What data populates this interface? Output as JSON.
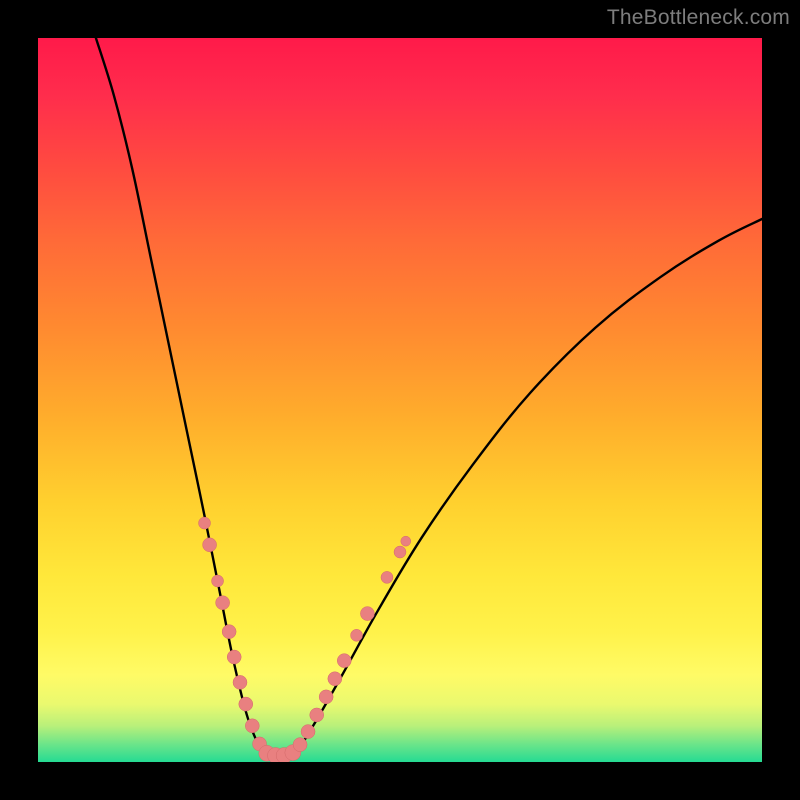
{
  "watermark": "TheBottleneck.com",
  "colors": {
    "curve_stroke": "#000000",
    "dot_fill": "#e98080",
    "dot_stroke": "#d46a6a",
    "tooltip_bg": "rgba(0,0,0,0.72)"
  },
  "chart_data": {
    "type": "line",
    "title": "",
    "xlabel": "",
    "ylabel": "",
    "xlim": [
      0,
      100
    ],
    "ylim": [
      0,
      100
    ],
    "grid": false,
    "legend": false,
    "note": "Valley curve. y encodes bottleneck percentage (0 at the valley floor, ~100 at top). x is an abstract hardware-balance axis. Lower is better (green).",
    "curve": {
      "description": "Asymmetric V: steep left branch from top-left to valley near x≈29–36, shallower right branch rising toward upper right.",
      "left_branch": [
        {
          "x": 8.0,
          "y": 100.0
        },
        {
          "x": 10.5,
          "y": 92.0
        },
        {
          "x": 13.0,
          "y": 82.0
        },
        {
          "x": 15.5,
          "y": 70.0
        },
        {
          "x": 18.0,
          "y": 58.0
        },
        {
          "x": 20.5,
          "y": 46.0
        },
        {
          "x": 23.0,
          "y": 34.0
        },
        {
          "x": 25.0,
          "y": 24.0
        },
        {
          "x": 27.0,
          "y": 14.0
        },
        {
          "x": 29.0,
          "y": 6.0
        },
        {
          "x": 31.0,
          "y": 1.5
        }
      ],
      "valley": [
        {
          "x": 31.0,
          "y": 1.5
        },
        {
          "x": 32.5,
          "y": 0.6
        },
        {
          "x": 34.0,
          "y": 0.6
        },
        {
          "x": 35.5,
          "y": 1.2
        }
      ],
      "right_branch": [
        {
          "x": 35.5,
          "y": 1.2
        },
        {
          "x": 38.0,
          "y": 5.0
        },
        {
          "x": 42.0,
          "y": 12.0
        },
        {
          "x": 47.0,
          "y": 21.0
        },
        {
          "x": 53.0,
          "y": 31.0
        },
        {
          "x": 60.0,
          "y": 41.0
        },
        {
          "x": 68.0,
          "y": 51.0
        },
        {
          "x": 77.0,
          "y": 60.0
        },
        {
          "x": 86.0,
          "y": 67.0
        },
        {
          "x": 94.0,
          "y": 72.0
        },
        {
          "x": 100.0,
          "y": 75.0
        }
      ]
    },
    "scatter": {
      "description": "Pink dots clustered along both branches of the V near the bottom.",
      "points": [
        {
          "x": 23.0,
          "y": 33.0,
          "r": 6
        },
        {
          "x": 23.7,
          "y": 30.0,
          "r": 7
        },
        {
          "x": 24.8,
          "y": 25.0,
          "r": 6
        },
        {
          "x": 25.5,
          "y": 22.0,
          "r": 7
        },
        {
          "x": 26.4,
          "y": 18.0,
          "r": 7
        },
        {
          "x": 27.1,
          "y": 14.5,
          "r": 7
        },
        {
          "x": 27.9,
          "y": 11.0,
          "r": 7
        },
        {
          "x": 28.7,
          "y": 8.0,
          "r": 7
        },
        {
          "x": 29.6,
          "y": 5.0,
          "r": 7
        },
        {
          "x": 30.6,
          "y": 2.5,
          "r": 7
        },
        {
          "x": 31.6,
          "y": 1.2,
          "r": 8
        },
        {
          "x": 32.8,
          "y": 0.9,
          "r": 8
        },
        {
          "x": 34.0,
          "y": 0.9,
          "r": 8
        },
        {
          "x": 35.2,
          "y": 1.3,
          "r": 8
        },
        {
          "x": 36.2,
          "y": 2.4,
          "r": 7
        },
        {
          "x": 37.3,
          "y": 4.2,
          "r": 7
        },
        {
          "x": 38.5,
          "y": 6.5,
          "r": 7
        },
        {
          "x": 39.8,
          "y": 9.0,
          "r": 7
        },
        {
          "x": 41.0,
          "y": 11.5,
          "r": 7
        },
        {
          "x": 42.3,
          "y": 14.0,
          "r": 7
        },
        {
          "x": 44.0,
          "y": 17.5,
          "r": 6
        },
        {
          "x": 45.5,
          "y": 20.5,
          "r": 7
        },
        {
          "x": 48.2,
          "y": 25.5,
          "r": 6
        },
        {
          "x": 50.0,
          "y": 29.0,
          "r": 6
        },
        {
          "x": 50.8,
          "y": 30.5,
          "r": 5
        }
      ]
    }
  }
}
